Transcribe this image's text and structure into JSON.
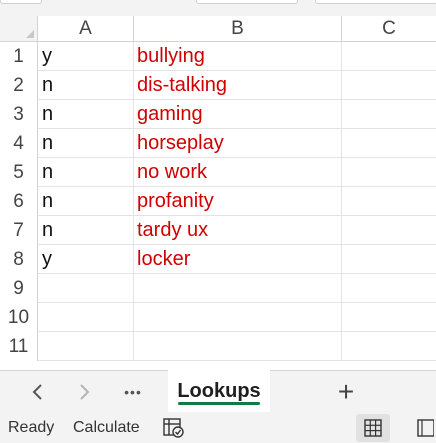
{
  "columns": [
    "A",
    "B",
    "C"
  ],
  "rows": [
    {
      "num": "1",
      "a": "y",
      "b": "bullying"
    },
    {
      "num": "2",
      "a": "n",
      "b": "dis-talking"
    },
    {
      "num": "3",
      "a": "n",
      "b": "gaming"
    },
    {
      "num": "4",
      "a": "n",
      "b": "horseplay"
    },
    {
      "num": "5",
      "a": "n",
      "b": "no work"
    },
    {
      "num": "6",
      "a": "n",
      "b": "profanity"
    },
    {
      "num": "7",
      "a": "n",
      "b": "tardy ux"
    },
    {
      "num": "8",
      "a": "y",
      "b": "locker"
    },
    {
      "num": "9",
      "a": "",
      "b": ""
    },
    {
      "num": "10",
      "a": "",
      "b": ""
    },
    {
      "num": "11",
      "a": "",
      "b": ""
    }
  ],
  "tabs": {
    "prev": "‹",
    "next": "›",
    "more": "•••",
    "active_sheet": "Lookups",
    "add": "+"
  },
  "status": {
    "ready": "Ready",
    "calculate": "Calculate"
  },
  "colors": {
    "lookup_text": "#d00000",
    "accent": "#107c41"
  },
  "icons": [
    "workbook-statistics-icon",
    "normal-view-icon",
    "page-layout-view-icon"
  ]
}
